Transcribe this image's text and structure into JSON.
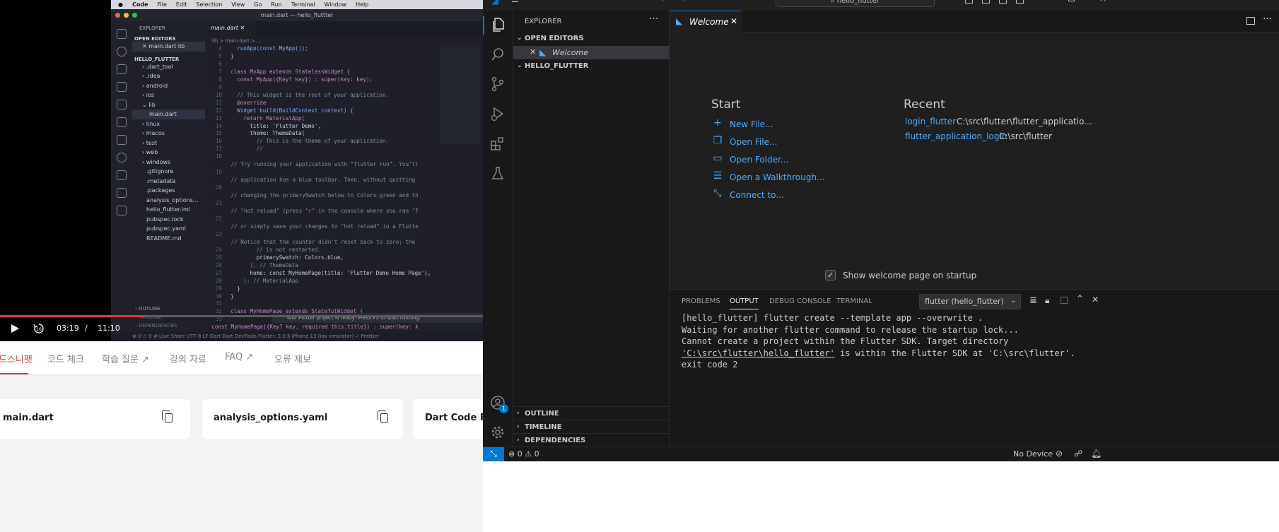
{
  "video": {
    "mac_menu": [
      "Code",
      "File",
      "Edit",
      "Selection",
      "View",
      "Go",
      "Run",
      "Terminal",
      "Window",
      "Help"
    ],
    "window_title": "main.dart — hello_fluttter",
    "explorer_label": "EXPLORER",
    "open_editors_label": "OPEN EDITORS",
    "open_editor_file": "main.dart lib",
    "project_label": "HELLO_FLUTTER",
    "files": [
      ".dart_tool",
      ".idea",
      "android",
      "ios",
      "lib",
      "main.dart",
      "linux",
      "macos",
      "test",
      "web",
      "windows",
      ".gitignore",
      ".metadata",
      ".packages",
      "analysis_options...",
      "hello_flutter.iml",
      "pubspec.lock",
      "pubspec.yaml",
      "README.md"
    ],
    "tab": "main.dart",
    "breadcrumb": "lib > main.dart > ...",
    "outline_label": "OUTLINE",
    "timeline_label": "TIMELINE",
    "dependencies_label": "DEPENDENCIES",
    "toast": "Your Flutter project is ready! Press F5 to start running.",
    "status": "⊗ 0 ⚠ 0   ⇄ Live Share          UTF-8   LF   Dart   Dart DevTools   Flutter: 3.0.5   iPhone 13 (ios simulator)   ✓ Prettier",
    "current_time": "03:19",
    "separator": "/",
    "total_time": "11:10",
    "progress": 0.297
  },
  "lecture_tabs": [
    "코드스니펫",
    "코드 체크",
    "학습 질문 ↗",
    "강의 자료",
    "FAQ ↗",
    "오류 제보"
  ],
  "snippets": [
    "main.dart",
    "analysis_options.yaml",
    "Dart Code Re"
  ],
  "vscode": {
    "search_text": "hello_flutter",
    "explorer_label": "EXPLORER",
    "open_editors_label": "OPEN EDITORS",
    "open_editor_item": "Welcome",
    "project_label": "HELLO_FLUTTER",
    "outline_label": "OUTLINE",
    "timeline_label": "TIMELINE",
    "dependencies_label": "DEPENDENCIES",
    "tab_label": "Welcome",
    "start_label": "Start",
    "start_items": [
      "New File...",
      "Open File...",
      "Open Folder...",
      "Open a Walkthrough...",
      "Connect to..."
    ],
    "recent_label": "Recent",
    "recent": [
      {
        "name": "login_flutter",
        "path": "C:\\src\\flutter\\flutter_applicatio..."
      },
      {
        "name": "flutter_application_login",
        "path": "C:\\src\\flutter"
      }
    ],
    "show_welcome": "Show welcome page on startup",
    "panel_tabs": [
      "PROBLEMS",
      "OUTPUT",
      "DEBUG CONSOLE",
      "TERMINAL"
    ],
    "output_channel": "flutter (hello_flutter)",
    "output_lines": [
      "[hello_flutter] flutter create --template app --overwrite .",
      "Waiting for another flutter command to release the startup lock...",
      "Cannot create a project within the Flutter SDK. Target directory",
      "'C:\\src\\flutter\\hello_flutter' is within the Flutter SDK at 'C:\\src\\flutter'.",
      "exit code 2"
    ],
    "status_errors": "0",
    "status_warnings": "0",
    "status_device": "No Device",
    "account_badge": "1"
  }
}
